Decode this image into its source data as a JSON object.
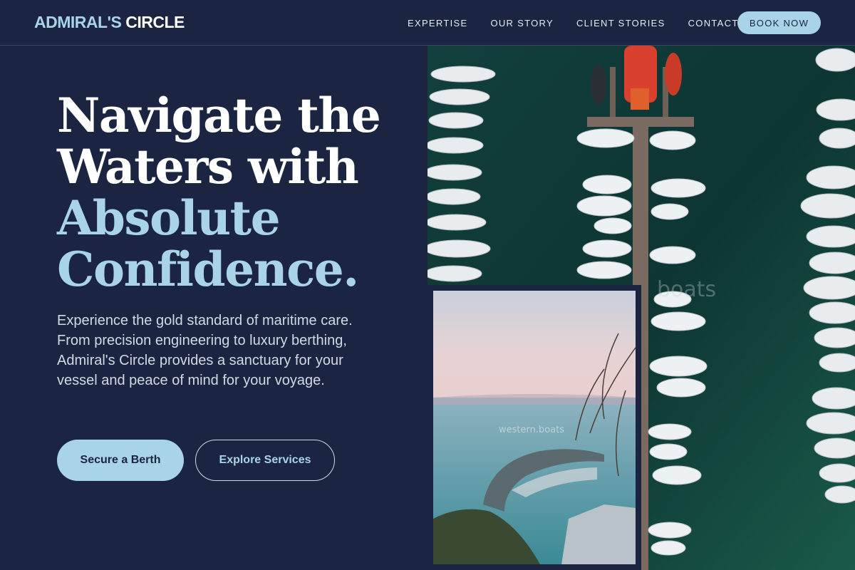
{
  "brand": {
    "part1": "ADMIRAL'S",
    "part2": "CIRCLE"
  },
  "nav": {
    "items": [
      "EXPERTISE",
      "OUR STORY",
      "CLIENT STORIES",
      "CONTACT"
    ],
    "cta": "BOOK NOW"
  },
  "hero": {
    "headline_line1": "Navigate the",
    "headline_line2": "Waters with",
    "headline_line3": "Absolute",
    "headline_line4": "Confidence.",
    "lead": "Experience the gold standard of maritime care. From precision engineering to luxury berthing, Admiral's Circle provides a sanctuary for your vessel and peace of mind for your voyage.",
    "primary_cta": "Secure a Berth",
    "secondary_cta": "Explore Services"
  },
  "images": {
    "marina_watermark": "boats",
    "inset_watermark": "western.boats"
  },
  "colors": {
    "background": "#1b2440",
    "accent": "#a8d4e6",
    "white": "#ffffff",
    "water": "#0f3a3a"
  }
}
